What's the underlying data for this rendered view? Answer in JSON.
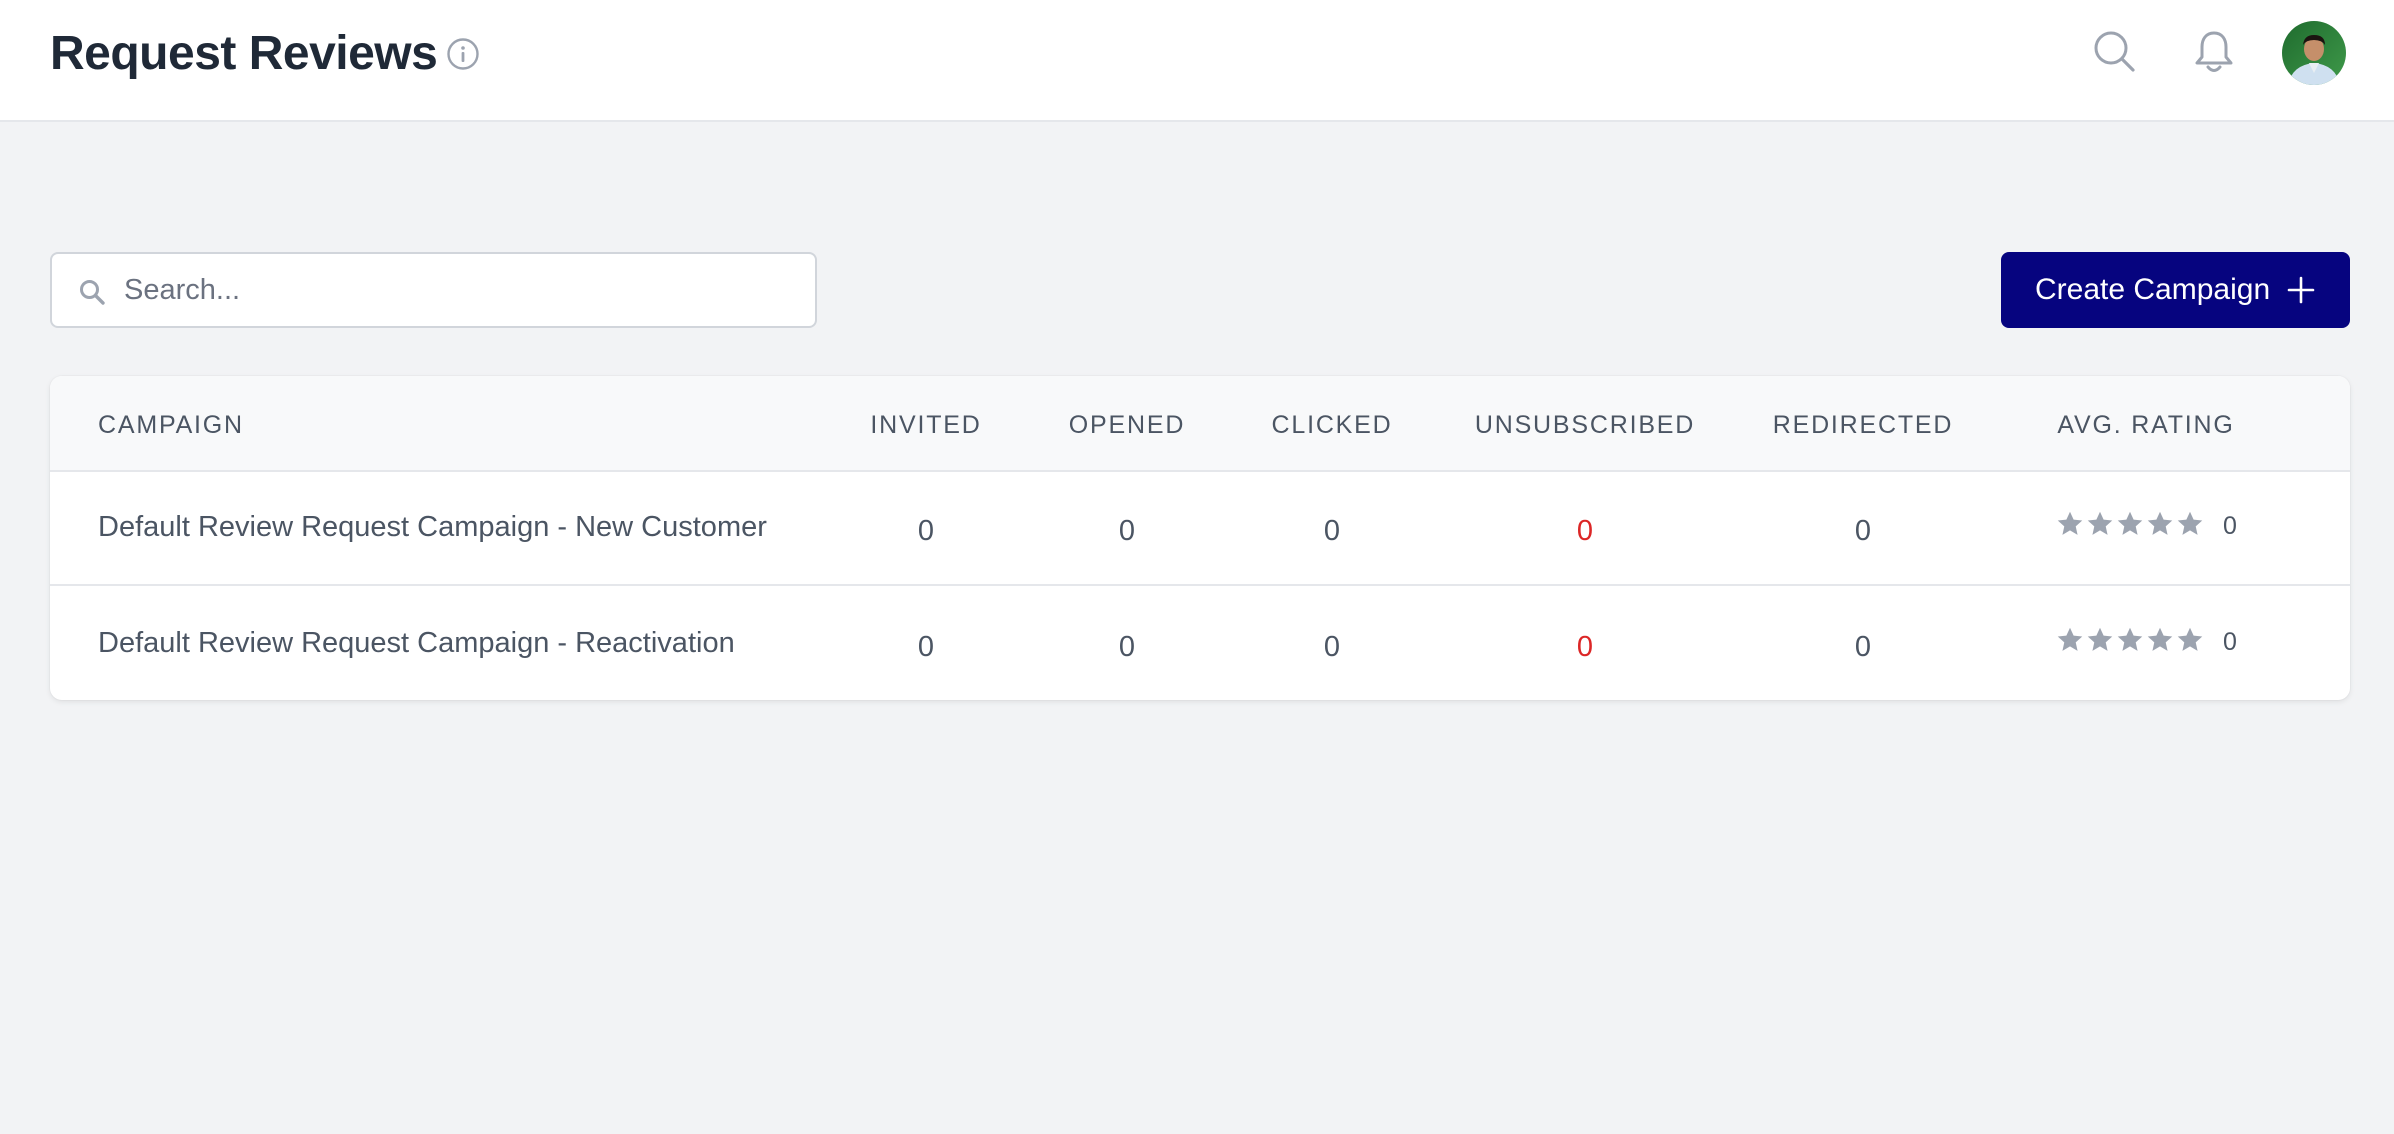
{
  "header": {
    "title": "Request Reviews",
    "icons": {
      "info": "info-icon",
      "search": "search-icon",
      "notifications": "bell-icon",
      "avatar": "user-avatar"
    }
  },
  "toolbar": {
    "search_placeholder": "Search...",
    "search_value": "",
    "create_button_label": "Create Campaign",
    "create_button_icon": "plus-icon"
  },
  "table": {
    "columns": [
      "Campaign",
      "Invited",
      "Opened",
      "Clicked",
      "Unsubscribed",
      "Redirected",
      "Avg. Rating"
    ],
    "rows": [
      {
        "campaign": "Default Review Request Campaign - New Customer",
        "invited": "0",
        "opened": "0",
        "clicked": "0",
        "unsubscribed": "0",
        "redirected": "0",
        "avg_rating_stars": 0,
        "avg_rating": "0"
      },
      {
        "campaign": "Default Review Request Campaign - Reactivation",
        "invited": "0",
        "opened": "0",
        "clicked": "0",
        "unsubscribed": "0",
        "redirected": "0",
        "avg_rating_stars": 0,
        "avg_rating": "0"
      }
    ]
  },
  "colors": {
    "primary_button": "#06047f",
    "unsubscribed_text": "#dc2626",
    "star_empty": "#9ca3af",
    "background": "#f2f3f5"
  }
}
